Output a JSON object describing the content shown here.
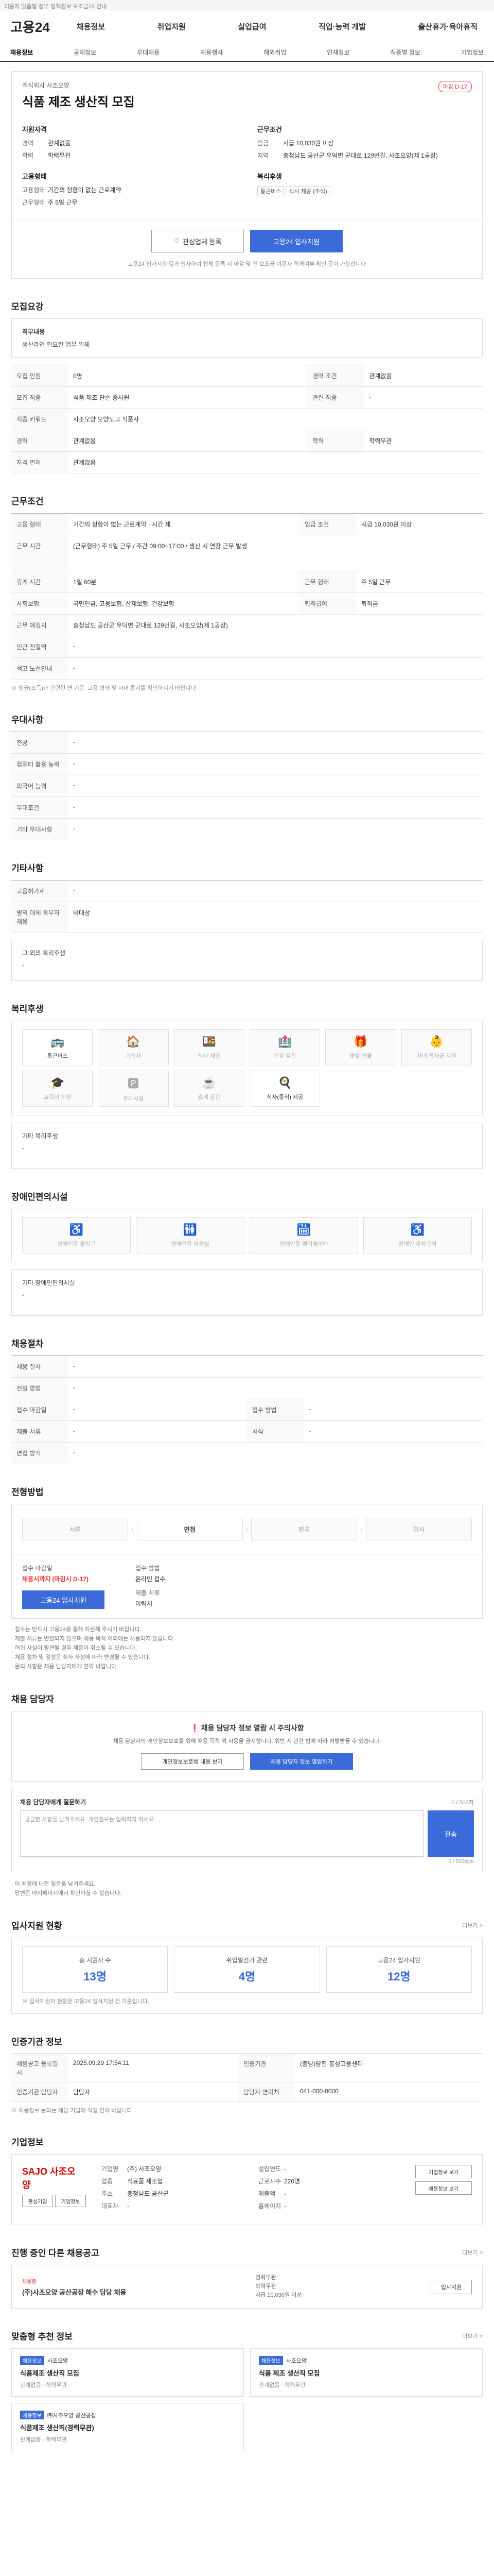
{
  "topbar": {
    "left": "이용자 맞춤형 정부 정책정보 보조금24 안내",
    "right": ""
  },
  "header": {
    "logo": "고용24",
    "nav": [
      "채용정보",
      "취업지원",
      "실업급여",
      "직업·능력 개발",
      "출산휴가·육아휴직"
    ]
  },
  "subnav": [
    "채용정보",
    "공채정보",
    "우대채용",
    "채용행사",
    "해외취업",
    "인재정보",
    "직종별 정보",
    "기업정보"
  ],
  "job": {
    "company": "주식회사 사조오양",
    "title": "식품 제조 생산직 모집",
    "badge": "마감 D-17",
    "qual_h": "지원자격",
    "qual": [
      {
        "k": "경력",
        "v": "관계없음"
      },
      {
        "k": "학력",
        "v": "학력무관"
      }
    ],
    "cond_h": "근무조건",
    "cond": [
      {
        "k": "임금",
        "v": "시급 10,030원 이상"
      },
      {
        "k": "지역",
        "v": "충청남도 공산군 우덕면 군대로 129번길, 사조오양(제 1공장)"
      }
    ],
    "type_h": "고용형태",
    "type": [
      {
        "k": "고용형태",
        "v": "기간의 정함이 없는 근로계약"
      },
      {
        "k": "근무형태",
        "v": "주 5일 근무"
      }
    ],
    "welfare_h": "복리후생",
    "welfare_tags": [
      "통근버스",
      "식사 제공 (조식)"
    ]
  },
  "apply": {
    "like": "관심업체 등록",
    "apply": "고용24 입사지원",
    "note": "고용24 입사지원 결과 입사하여 업체 등록 시 마감 및 전 보조금 이용자 적격여부 확인 등이 가능합니다"
  },
  "summary_sec": {
    "title": "모집요강",
    "box_h": "직무내용",
    "box_txt": "생산라인 필요한 업무 일체"
  },
  "recruit_tbl": [
    [
      "모집 인원",
      "0명",
      "경력 조건",
      "관계없음"
    ],
    [
      "모집 직종",
      "식품 제조 단순 종사원",
      "관련 직종",
      "-"
    ],
    [
      "직종 키워드",
      "사조오양 오양노고 식품사",
      "",
      ""
    ],
    [
      "경력",
      "관계없음",
      "학력",
      "학력무관"
    ],
    [
      "자격 면허",
      "관계없음",
      "",
      ""
    ]
  ],
  "work_sec": {
    "title": "근무조건"
  },
  "work_tbl": [
    [
      "고용 형태",
      "기간의 정함이 없는 근로계약 · 시간 제",
      "임금 조건",
      "시급 10,030원 이상"
    ],
    [
      "근무 시간",
      "(근무형태) 주 5일 근무 / 주간 09:00~17:00 / 생산 시 연장 근무 발생",
      "",
      ""
    ],
    [
      "휴게 시간",
      "1일 60분",
      "근무 형태",
      "주 5일 근무"
    ],
    [
      "사회보험",
      "국민연금, 고용보험, 산재보험, 건강보험",
      "퇴직급여",
      "퇴직금"
    ],
    [
      "근무 예정지",
      "충청남도 공산군 우덕면 군대로 129번길, 사조오양(제 1공장)",
      "",
      ""
    ],
    [
      "인근 전철역",
      "-",
      "",
      ""
    ],
    [
      "색고 노선안내",
      "-",
      "",
      ""
    ]
  ],
  "work_note": "※ 임금(소득)과 관련된 연 기준, 고용 형태 및 사내 통지를 확인하시기 바랍니다.",
  "pref_sec": {
    "title": "우대사항"
  },
  "pref_tbl": [
    [
      "전공",
      "-"
    ],
    [
      "컴퓨터 활용 능력",
      "-"
    ],
    [
      "외국어 능력",
      "-"
    ],
    [
      "우대조건",
      "-"
    ],
    [
      "기타 우대사항",
      "-"
    ]
  ],
  "etc_sec": {
    "title": "기타사항"
  },
  "etc_tbl": [
    [
      "고용허가제",
      "-"
    ],
    [
      "병역 대체 복무자 채용",
      "비대상"
    ]
  ],
  "etc_box_h": "그 외의 복리후생",
  "etc_box_v": "-",
  "wel_sec": {
    "title": "복리후생"
  },
  "wel_items": [
    {
      "icon": "🚌",
      "name": "통근버스",
      "on": true
    },
    {
      "icon": "🏠",
      "name": "기숙사",
      "on": false
    },
    {
      "icon": "🍱",
      "name": "식사 제공",
      "on": false
    },
    {
      "icon": "🏥",
      "name": "건강 검진",
      "on": false
    },
    {
      "icon": "🎁",
      "name": "명절 선물",
      "on": false
    },
    {
      "icon": "👶",
      "name": "자녀 학자금 지원",
      "on": false
    },
    {
      "icon": "🎓",
      "name": "교육비 지원",
      "on": false
    },
    {
      "icon": "🅿",
      "name": "주차시설",
      "on": false
    },
    {
      "icon": "☕",
      "name": "휴게 공간",
      "on": false
    },
    {
      "icon": "🍳",
      "name": "식사(중식) 제공",
      "on": true
    }
  ],
  "wel_box_h": "기타 복리후생",
  "wel_box_v": "-",
  "fac_sec": {
    "title": "장애인편의시설"
  },
  "fac_items": [
    {
      "icon": "♿",
      "name": "장애인용 출입구"
    },
    {
      "icon": "🚻",
      "name": "장애인용 화장실"
    },
    {
      "icon": "🛗",
      "name": "장애인용 엘리베이터"
    },
    {
      "icon": "♿",
      "name": "장애인 주차구역"
    }
  ],
  "fac_box_h": "기타 장애인편의시설",
  "fac_box_v": "-",
  "proc_sec": {
    "title": "채용절차"
  },
  "proc_tbl": [
    [
      "채용 절차",
      "-",
      "",
      ""
    ],
    [
      "전형 방법",
      "-",
      "",
      ""
    ],
    [
      "접수 마감일",
      "-",
      "접수 방법",
      "-"
    ],
    [
      "제출 서류",
      "-",
      "서식",
      "-"
    ],
    [
      "면접 방식",
      "-",
      "",
      ""
    ]
  ],
  "step_sec": {
    "title": "전형방법"
  },
  "steps": [
    "서류",
    "면접",
    "합격",
    "입사"
  ],
  "apply_info": {
    "k1": "접수 마감일",
    "v1": "채용시까지 (마감시 D-17)",
    "k2": "접수 방법",
    "v2": "온라인 접수",
    "k3": "제출 서류",
    "v3": "이력서",
    "btn": "고용24 입사지원"
  },
  "bullets": [
    "· 접수는 반드시 고용24를 통해 지원해 주시기 바랍니다.",
    "· 제출 서류는 반환되지 않으며 채용 목적 이외에는 사용되지 않습니다.",
    "· 허위 사실이 발견될 경우 채용이 취소될 수 있습니다.",
    "· 채용 절차 및 일정은 회사 사정에 따라 변경될 수 있습니다.",
    "· 문의 사항은 채용 담당자에게 연락 바랍니다."
  ],
  "contact_sec": {
    "title": "채용 담당자"
  },
  "contact": {
    "warn_a": "채용 담당자 정보 열람 시 주의사항",
    "txt": "채용 담당자의 개인정보보호를 위해 채용 목적 외 사용을 금지합니다. 위반 시 관련 법에 따라 처벌받을 수 있습니다.",
    "btn1": "개인정보보호법 내용 보기",
    "btn2": "채용 담당자 정보 열람하기"
  },
  "qa": {
    "title": "채용 담당자에게 질문하기",
    "hint": "0 / 500자",
    "placeholder": "궁금한 사항을 남겨주세요. 개인정보는 입력하지 마세요.",
    "btn": "전송",
    "counter": "0 / 500byte"
  },
  "qa_notes": [
    "· 이 채용에 대한 질문을 남겨주세요.",
    "· 답변은 마이페이지에서 확인하실 수 있습니다."
  ],
  "stat_sec": {
    "title": "입사지원 현황",
    "link": "더보기 >"
  },
  "stats": [
    {
      "k": "총 지원자 수",
      "v": "13명"
    },
    {
      "k": "취업알선가 관련",
      "v": "4명"
    },
    {
      "k": "고용24 입사지원",
      "v": "12명"
    }
  ],
  "stat_note": "※ 입사지원자 현황은 고용24 입사지원 건 기준입니다.",
  "inst_sec": {
    "title": "인증기관 정보"
  },
  "inst_tbl": [
    [
      "채용공고 등록일시",
      "2025.09.29 17:54:11",
      "인증기관",
      "(충남)당진·홍성고용센터"
    ],
    [
      "인증기관 담당자",
      "담당자",
      "담당자 연락처",
      "041-000-0000"
    ]
  ],
  "inst_note": "※ 채용정보 문의는 해당 기업에 직접 연락 바랍니다.",
  "corp_sec": {
    "title": "기업정보"
  },
  "corp": {
    "logo": "SAJO 사조오양",
    "btn1": "관심기업",
    "btn2": "기업정보",
    "rows": [
      {
        "k": "기업명",
        "v": "(주) 사조오양"
      },
      {
        "k": "업종",
        "v": "식료품 제조업"
      },
      {
        "k": "주소",
        "v": "충청남도 공산군"
      },
      {
        "k": "대표자",
        "v": "-"
      }
    ],
    "rows2": [
      {
        "k": "설립연도",
        "v": "-"
      },
      {
        "k": "근로자수",
        "v": "220명"
      },
      {
        "k": "매출액",
        "v": "-"
      },
      {
        "k": "홈페이지",
        "v": "-"
      }
    ],
    "side": [
      "기업정보 보기",
      "채용정보 보기"
    ]
  },
  "other_sec": {
    "title": "진행 중인 다른 채용공고",
    "link": "더보기 >"
  },
  "other": {
    "tag": "채용중",
    "company": "(주)사조오양 공산공장 해수 담당 채용",
    "meta": [
      "경력무관",
      "학력무관",
      "시급 10,030원 이상"
    ],
    "btn": "입사지원"
  },
  "rec_sec": {
    "title": "맞춤형 추천 정보",
    "link": "더보기 >"
  },
  "recs": [
    {
      "tag": "채용정보",
      "company": "사조오양",
      "t": "식품제조 생산직 모집",
      "m": "관계없음 · 학력무관"
    },
    {
      "tag": "채용정보",
      "company": "사조오양",
      "t": "식품 제조 생산직 모집",
      "m": "관계없음 · 학력무관"
    },
    {
      "tag": "채용정보",
      "company": "㈜사조오양 공산공장",
      "t": "식품제조 생산직(경력무관)",
      "m": "관계없음 · 학력무관"
    }
  ]
}
